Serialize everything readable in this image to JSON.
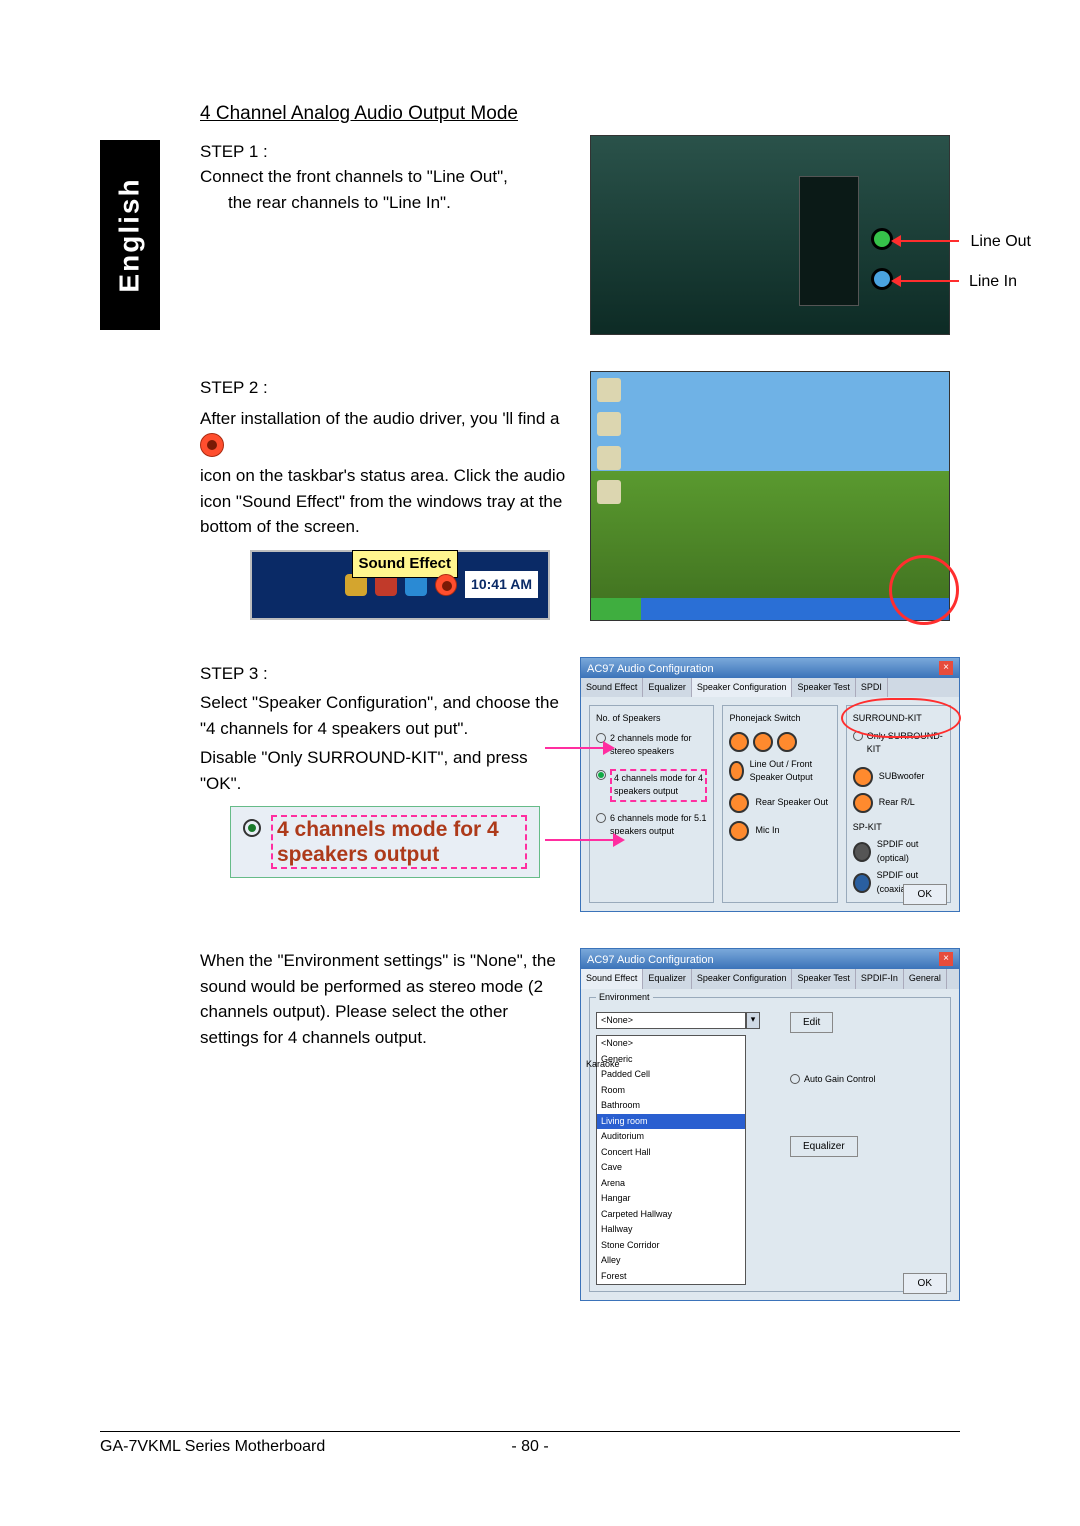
{
  "language_tab": "English",
  "section_title": "4 Channel Analog Audio Output Mode",
  "step1": {
    "label": "STEP 1 :",
    "line1": "Connect the front channels to \"Line Out\",",
    "line2": "the rear channels to \"Line In\".",
    "callout_lineout": "Line Out",
    "callout_linein": "Line In"
  },
  "step2": {
    "label": "STEP 2 :",
    "line1": "After installation of the audio driver, you 'll find a",
    "line2": "icon on the taskbar's status area. Click the audio icon \"Sound Effect\" from the windows tray at the bottom of the screen.",
    "tray_label": "Sound Effect",
    "tray_time": "10:41 AM"
  },
  "step3": {
    "label": "STEP 3 :",
    "line1": "Select \"Speaker Configuration\", and choose the \"4 channels for 4 speakers out put\".",
    "line2": "Disable \"Only SURROUND-KIT\", and press \"OK\".",
    "zoom_text": "4 channels mode for 4 speakers output",
    "win": {
      "title": "AC97 Audio Configuration",
      "tabs": [
        "Sound Effect",
        "Equalizer",
        "Speaker Configuration",
        "Speaker Test",
        "SPDI"
      ],
      "fieldset_speakers": "No. of Speakers",
      "radio_2ch": "2 channels mode for stereo speakers",
      "radio_4ch": "4 channels mode for 4 speakers output",
      "radio_6ch": "6 channels mode for 5.1 speakers output",
      "fieldset_phone": "Phonejack Switch",
      "phone_line": "Line Out / Front Speaker Output",
      "phone_rear": "Rear Speaker Out",
      "phone_mic": "Mic In",
      "surround_label": "SURROUND-KIT",
      "only_surround": "Only SURROUND-KIT",
      "sub": "SUBwoofer",
      "rear_rl": "Rear R/L",
      "spkit": "SP-KIT",
      "spdif_opt": "SPDIF out (optical)",
      "spdif_coax": "SPDIF out (coaxial)",
      "ok": "OK"
    }
  },
  "step4": {
    "line1": "When the \"Environment settings\" is \"None\", the sound would be performed as stereo mode (2 channels output). Please select the other settings for 4 channels output.",
    "win": {
      "title": "AC97 Audio Configuration",
      "tabs": [
        "Sound Effect",
        "Equalizer",
        "Speaker Configuration",
        "Speaker Test",
        "SPDIF-In",
        "General"
      ],
      "env_label": "Environment",
      "selected": "<None>",
      "options": [
        "<None>",
        "Generic",
        "Padded Cell",
        "Room",
        "Bathroom",
        "Living room",
        "Auditorium",
        "Concert Hall",
        "Cave",
        "Arena",
        "Hangar",
        "Carpeted Hallway",
        "Hallway",
        "Stone Corridor",
        "Alley",
        "Forest"
      ],
      "karaoke": "Karaoke",
      "btn_edit": "Edit",
      "auto_gain": "Auto Gain Control",
      "equalizer_btn": "Equalizer",
      "ok": "OK"
    }
  },
  "footer": {
    "left": "GA-7VKML Series Motherboard",
    "center": "- 80 -"
  }
}
